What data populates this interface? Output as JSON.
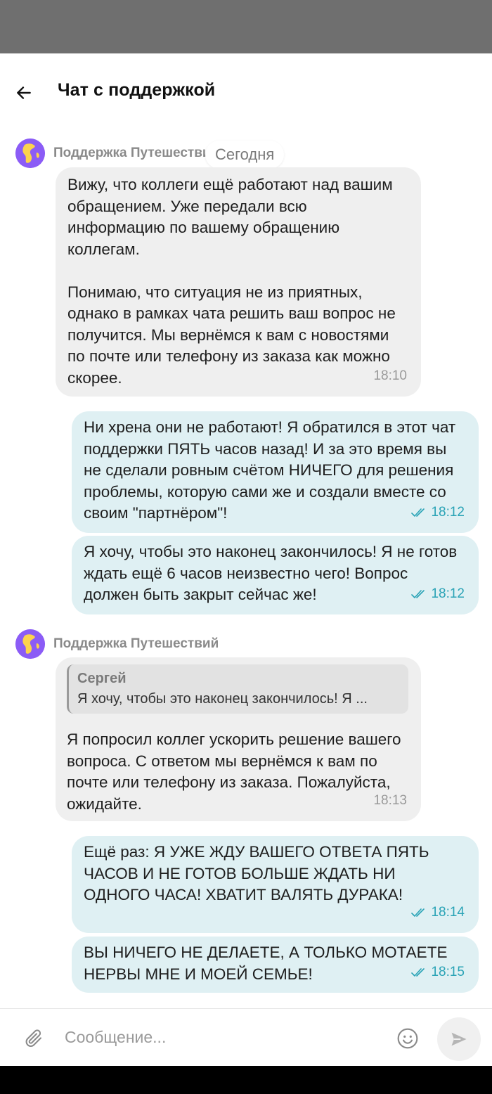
{
  "header": {
    "title": "Чат с поддержкой"
  },
  "date_chip": "Сегодня",
  "groups": [
    {
      "sender": "Поддержка Путешествий",
      "messages": [
        {
          "text": "Вижу, что коллеги ещё работают над вашим обращением. Уже передали всю информацию по вашему обращению коллегам.\n\nПонимаю, что ситуация не из приятных, однако в рамках чата решить ваш вопрос не получится. Мы вернёмся к вам с новостями по почте или телефону из заказа как можно скорее.",
          "time": "18:10"
        }
      ]
    },
    {
      "sender": "",
      "messages": [
        {
          "text": "Ни хрена они не работают! Я обратился в этот чат поддержки ПЯТЬ часов назад! И за это время вы не сделали ровным счётом НИЧЕГО для решения проблемы, которую сами же и создали вместе со своим \"партнёром\"!",
          "time": "18:12",
          "status": "read"
        },
        {
          "text": "Я хочу, чтобы это наконец закончилось!  Я не готов ждать ещё 6 часов неизвестно чего! Вопрос должен быть закрыт сейчас же!",
          "time": "18:12",
          "status": "read"
        }
      ]
    },
    {
      "sender": "Поддержка Путешествий",
      "messages": [
        {
          "quote": {
            "author": "Сергей",
            "text": "Я хочу, чтобы это наконец закончилось! Я ..."
          },
          "text": "Я попросил коллег ускорить решение вашего вопроса. С ответом мы вернёмся к вам по почте или телефону из заказа. Пожалуйста, ожидайте.",
          "time": "18:13"
        }
      ]
    },
    {
      "sender": "",
      "messages": [
        {
          "text": "Ещё раз: Я УЖЕ ЖДУ ВАШЕГО ОТВЕТА ПЯТЬ ЧАСОВ И НЕ ГОТОВ БОЛЬШЕ ЖДАТЬ НИ ОДНОГО ЧАСА! ХВАТИТ ВАЛЯТЬ ДУРАКА!",
          "time": "18:14",
          "status": "read"
        },
        {
          "text": "ВЫ НИЧЕГО НЕ ДЕЛАЕТЕ, А ТОЛЬКО МОТАЕТЕ НЕРВЫ МНЕ И МОЕЙ СЕМЬЕ!",
          "time": "18:15",
          "status": "read"
        }
      ]
    }
  ],
  "composer": {
    "placeholder": "Сообщение..."
  },
  "colors": {
    "incoming_bubble": "#efefef",
    "outgoing_bubble": "#dff0f3",
    "accent": "#2aa3b6",
    "avatar": "#8b5cf6"
  },
  "icons": [
    "back-arrow-icon",
    "globe-avatar-icon",
    "double-check-icon",
    "paperclip-icon",
    "emoji-icon",
    "send-icon"
  ]
}
